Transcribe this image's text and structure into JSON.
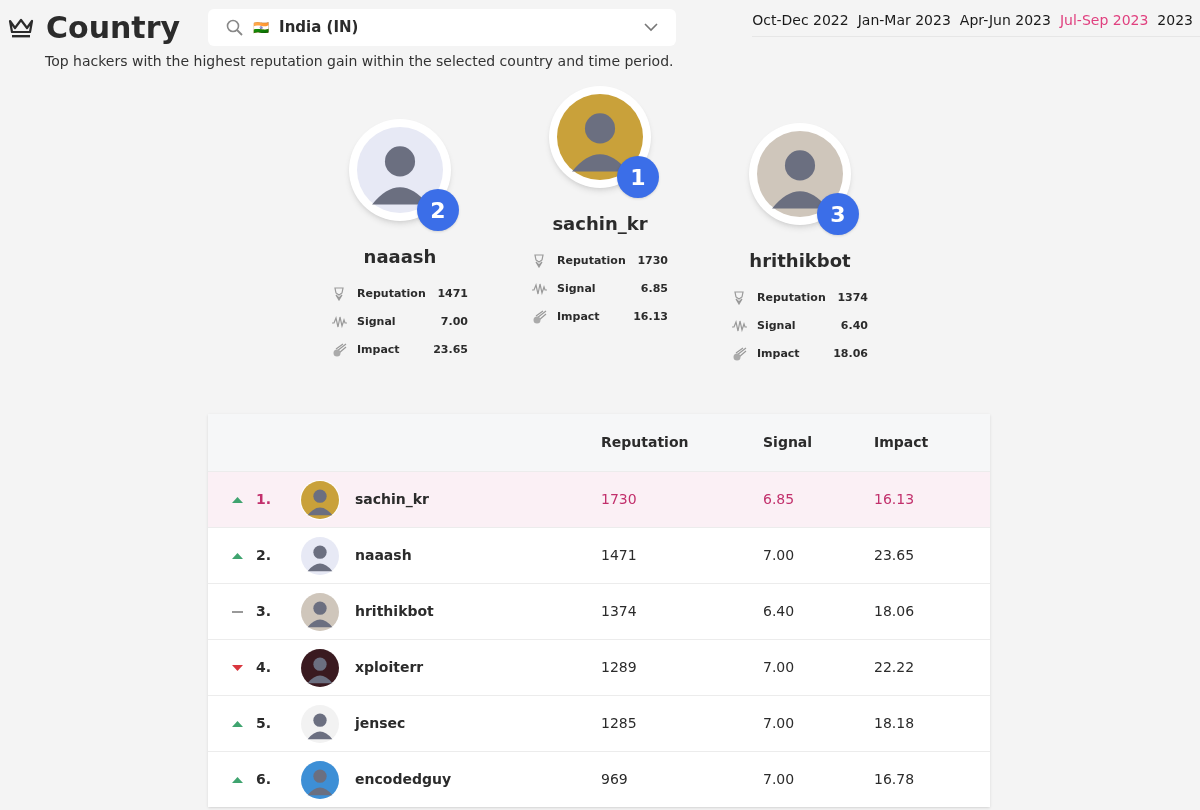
{
  "header": {
    "title": "Country",
    "country_select": {
      "flag": "🇮🇳",
      "value": "India (IN)"
    },
    "subtitle": "Top hackers with the highest reputation gain within the selected country and time period."
  },
  "periods": [
    {
      "label": "Oct-Dec 2022",
      "selected": false
    },
    {
      "label": "Jan-Mar 2023",
      "selected": false
    },
    {
      "label": "Apr-Jun 2023",
      "selected": false
    },
    {
      "label": "Jul-Sep 2023",
      "selected": true
    },
    {
      "label": "2023",
      "selected": false
    }
  ],
  "podium": [
    {
      "rank": "2",
      "name": "naaash",
      "stats": [
        {
          "kind": "reputation",
          "label": "Reputation",
          "value": "1471"
        },
        {
          "kind": "signal",
          "label": "Signal",
          "value": "7.00"
        },
        {
          "kind": "impact",
          "label": "Impact",
          "value": "23.65"
        }
      ]
    },
    {
      "rank": "1",
      "name": "sachin_kr",
      "stats": [
        {
          "kind": "reputation",
          "label": "Reputation",
          "value": "1730"
        },
        {
          "kind": "signal",
          "label": "Signal",
          "value": "6.85"
        },
        {
          "kind": "impact",
          "label": "Impact",
          "value": "16.13"
        }
      ]
    },
    {
      "rank": "3",
      "name": "hrithikbot",
      "stats": [
        {
          "kind": "reputation",
          "label": "Reputation",
          "value": "1374"
        },
        {
          "kind": "signal",
          "label": "Signal",
          "value": "6.40"
        },
        {
          "kind": "impact",
          "label": "Impact",
          "value": "18.06"
        }
      ]
    }
  ],
  "table": {
    "columns": [
      "Reputation",
      "Signal",
      "Impact"
    ],
    "rows": [
      {
        "kind": "up",
        "rank": "1.",
        "name": "sachin_kr",
        "reputation": "1730",
        "signal": "6.85",
        "impact": "16.13",
        "selected": true
      },
      {
        "kind": "up",
        "rank": "2.",
        "name": "naaash",
        "reputation": "1471",
        "signal": "7.00",
        "impact": "23.65",
        "selected": false
      },
      {
        "kind": "same",
        "rank": "3.",
        "name": "hrithikbot",
        "reputation": "1374",
        "signal": "6.40",
        "impact": "18.06",
        "selected": false
      },
      {
        "kind": "down",
        "rank": "4.",
        "name": "xploiterr",
        "reputation": "1289",
        "signal": "7.00",
        "impact": "22.22",
        "selected": false
      },
      {
        "kind": "up",
        "rank": "5.",
        "name": "jensec",
        "reputation": "1285",
        "signal": "7.00",
        "impact": "18.18",
        "selected": false
      },
      {
        "kind": "up",
        "rank": "6.",
        "name": "encodedguy",
        "reputation": "969",
        "signal": "7.00",
        "impact": "16.78",
        "selected": false
      }
    ]
  }
}
